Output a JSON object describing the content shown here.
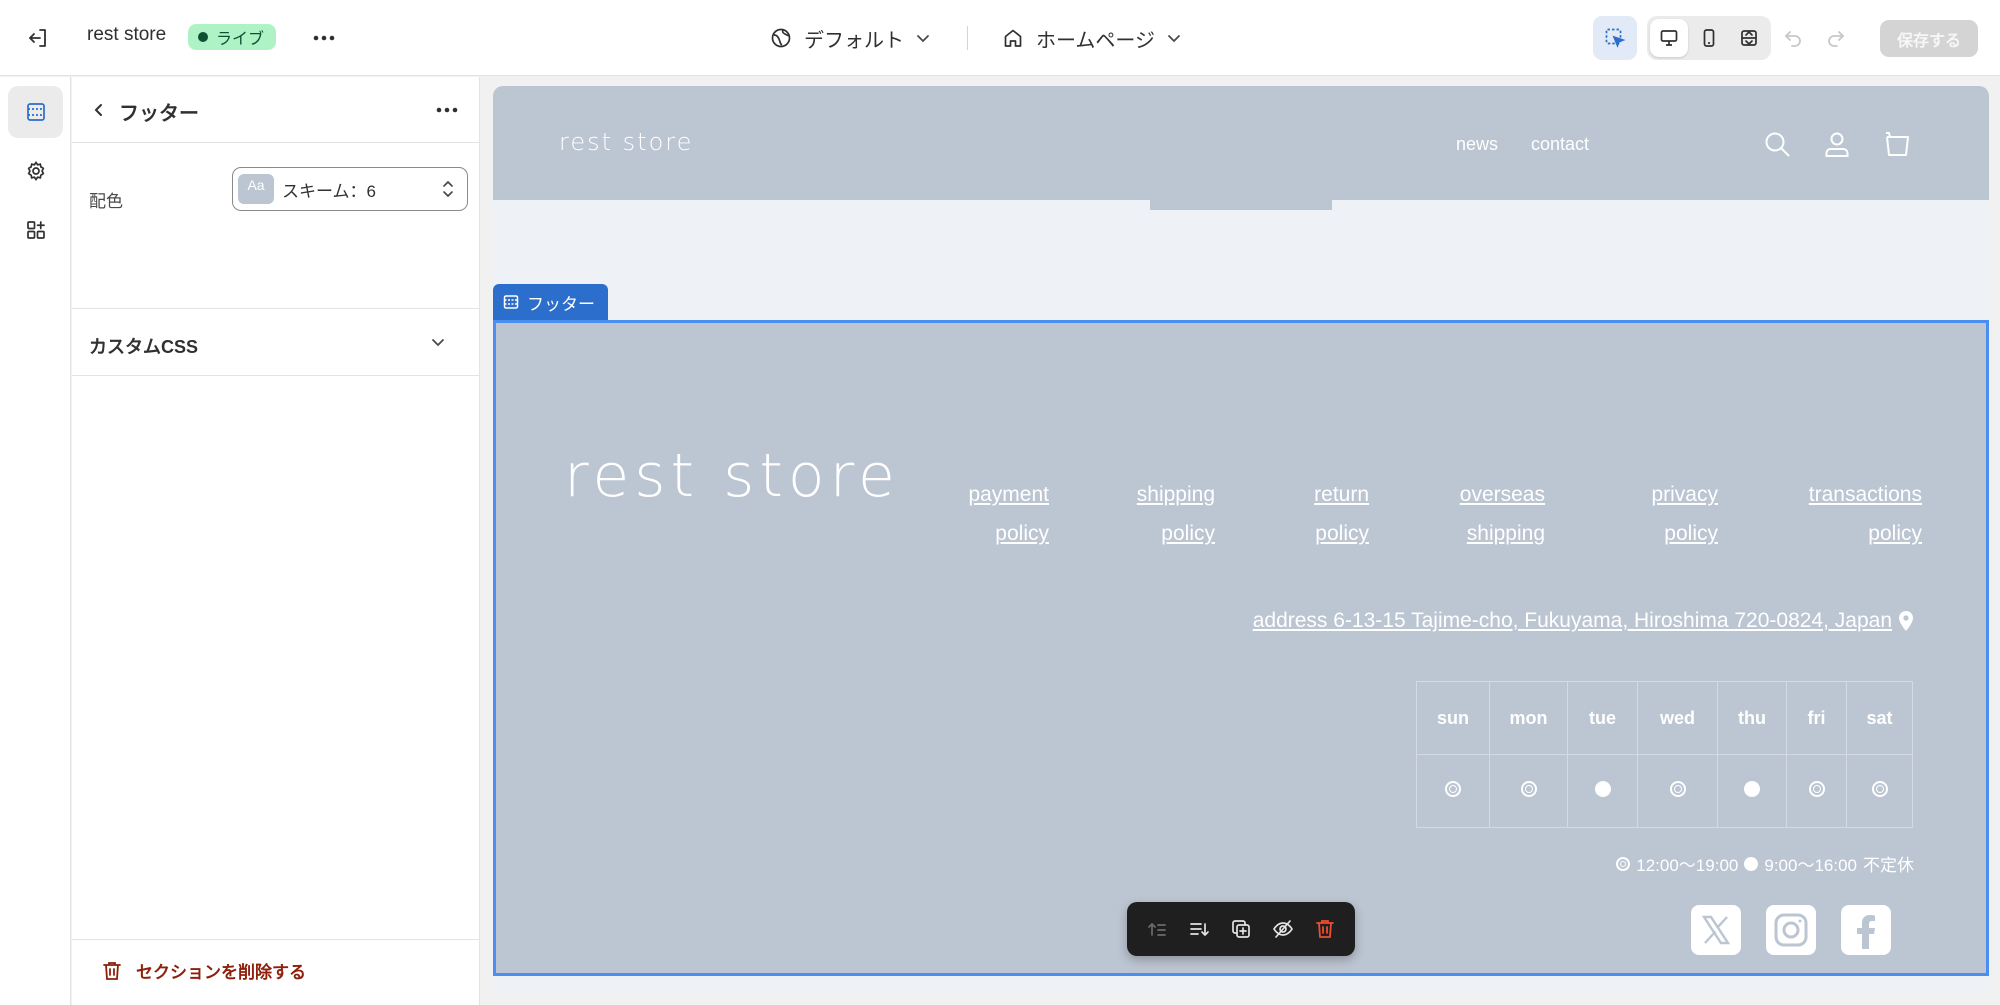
{
  "topbar": {
    "store_name": "rest store",
    "live_label": "ライブ",
    "theme_label": "デフォルト",
    "page_label": "ホームページ",
    "save_label": "保存する"
  },
  "panel": {
    "title": "フッター",
    "color_label": "配色",
    "scheme_chip": "Aa",
    "scheme_value": "スキーム：6",
    "custom_css_label": "カスタムCSS",
    "delete_label": "セクションを削除する"
  },
  "preview": {
    "header_logo": "rest store",
    "nav": [
      "news",
      "contact"
    ],
    "section_tag": "フッター",
    "footer_logo": "rest store",
    "policies": [
      {
        "line1": "payment",
        "line2": "policy"
      },
      {
        "line1": "shipping",
        "line2": "policy"
      },
      {
        "line1": "return",
        "line2": "policy"
      },
      {
        "line1": "overseas",
        "line2": "shipping"
      },
      {
        "line1": "privacy",
        "line2": "policy"
      },
      {
        "line1": "transactions",
        "line2": "policy"
      }
    ],
    "address": "address 6-13-15 Tajime-cho, Fukuyama, Hiroshima 720-0824, Japan",
    "days": [
      "sun",
      "mon",
      "tue",
      "wed",
      "thu",
      "fri",
      "sat"
    ],
    "day_marks": [
      "open",
      "open",
      "full",
      "open",
      "full",
      "open",
      "open"
    ],
    "legend_open": "12:00〜19:00",
    "legend_full": "9:00〜16:00",
    "legend_note": "不定休"
  },
  "colors": {
    "accent": "#2c6ecb",
    "section_bg": "#bcc5d2",
    "live_badge": "#aff2c5",
    "danger": "#8e1f0b"
  }
}
